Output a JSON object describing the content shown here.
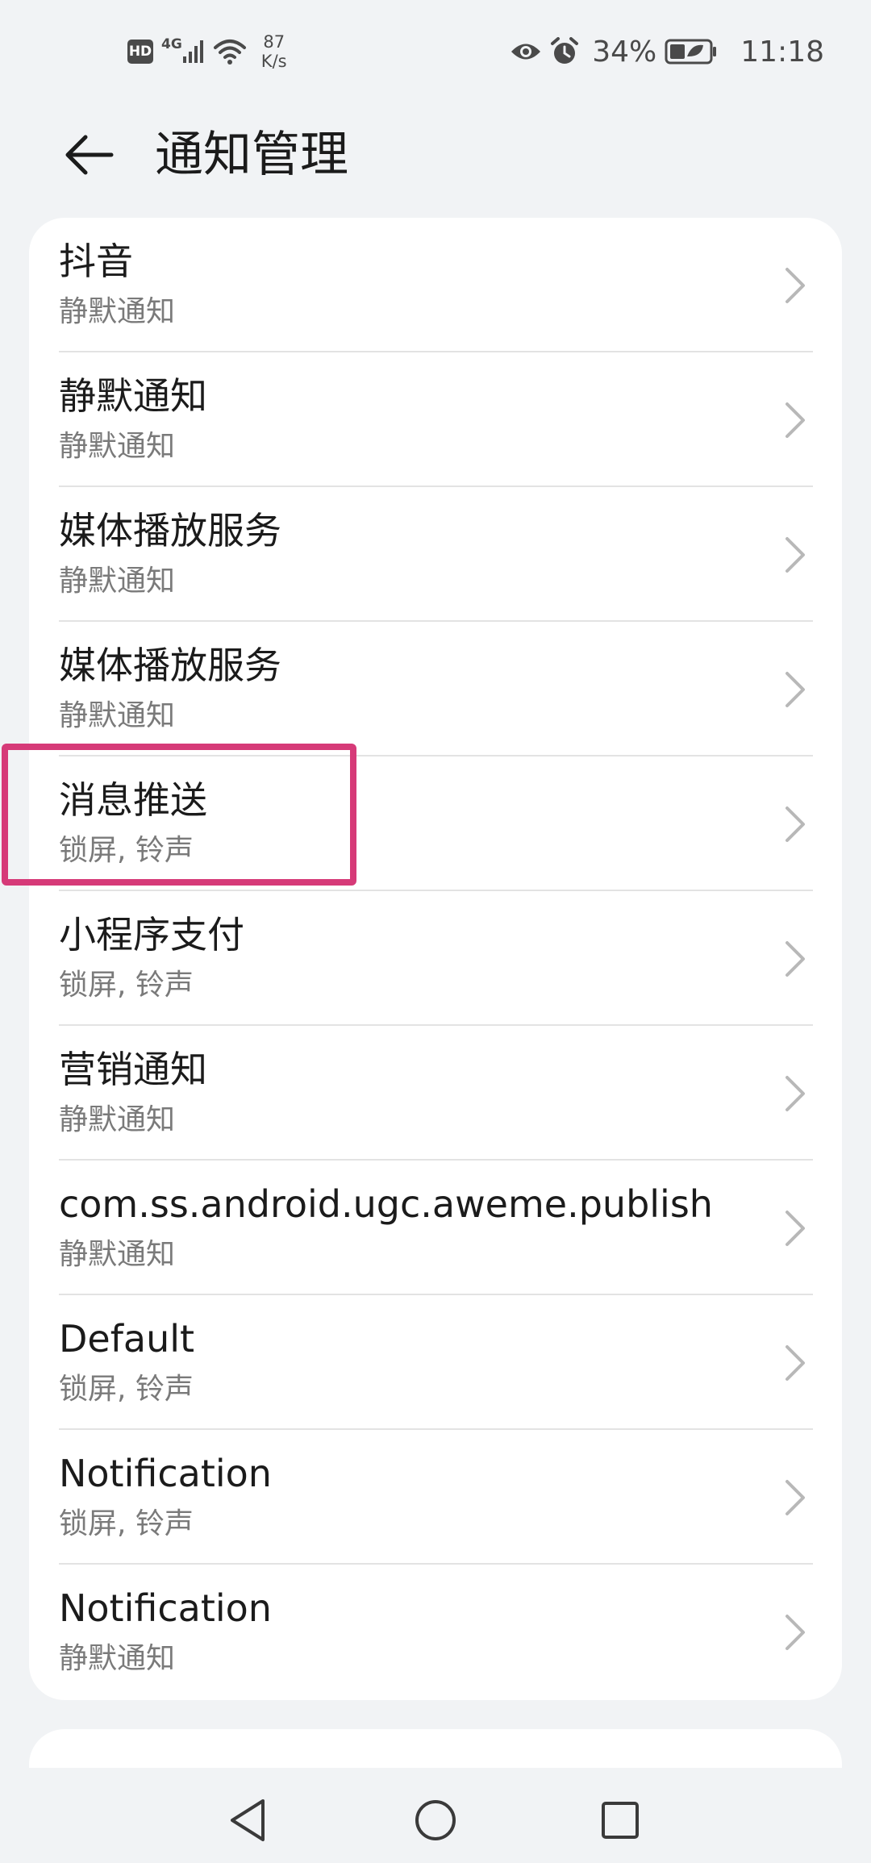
{
  "status_bar": {
    "hd": "HD",
    "network": "4G",
    "speed_value": "87",
    "speed_unit": "K/s",
    "battery": "34%",
    "time": "11:18"
  },
  "header": {
    "title": "通知管理"
  },
  "items": [
    {
      "title": "抖音",
      "subtitle": "静默通知"
    },
    {
      "title": "静默通知",
      "subtitle": "静默通知"
    },
    {
      "title": "媒体播放服务",
      "subtitle": "静默通知"
    },
    {
      "title": "媒体播放服务",
      "subtitle": "静默通知"
    },
    {
      "title": "消息推送",
      "subtitle": "锁屏, 铃声"
    },
    {
      "title": "小程序支付",
      "subtitle": "锁屏, 铃声"
    },
    {
      "title": "营销通知",
      "subtitle": "静默通知"
    },
    {
      "title": "com.ss.android.ugc.aweme.publish",
      "subtitle": "静默通知"
    },
    {
      "title": "Default",
      "subtitle": "锁屏, 铃声"
    },
    {
      "title": "Notification",
      "subtitle": "锁屏, 铃声"
    },
    {
      "title": "Notification",
      "subtitle": "静默通知"
    }
  ],
  "colors": {
    "highlight": "#d63a78",
    "background": "#f1f3f5"
  }
}
